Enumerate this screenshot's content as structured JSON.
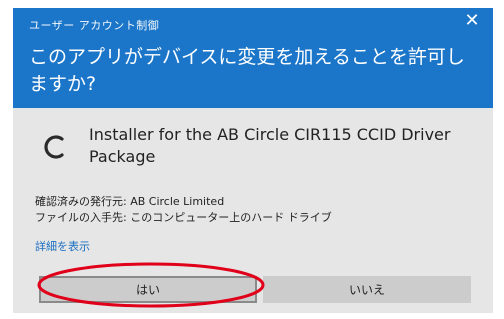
{
  "dialog": {
    "title": "ユーザー アカウント制御",
    "question": "このアプリがデバイスに変更を加えることを許可しますか?",
    "app_name": "Installer for the AB Circle CIR115 CCID Driver Package",
    "publisher_line": "確認済みの発行元: AB Circle Limited",
    "origin_line": "ファイルの入手先: このコンピューター上のハード ドライブ",
    "details_link": "詳細を表示",
    "yes_label": "はい",
    "no_label": "いいえ"
  },
  "icons": {
    "close": "close-icon",
    "app": "installer-app-icon"
  },
  "colors": {
    "header": "#1b76c9",
    "body": "#e6e6e6",
    "link": "#1b6fc0",
    "annotation": "#e0001a"
  }
}
